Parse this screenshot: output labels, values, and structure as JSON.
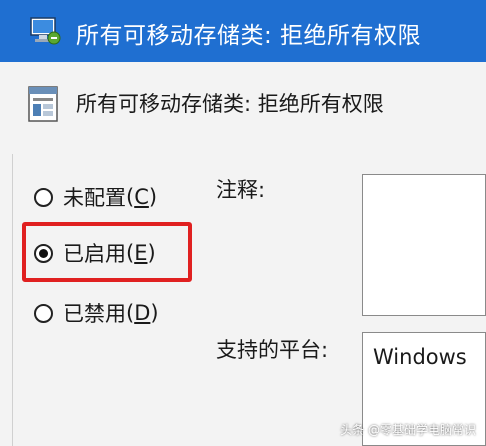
{
  "window": {
    "title": "所有可移动存储类: 拒绝所有权限",
    "title_bar_color": "#1f6fd1"
  },
  "policy": {
    "title": "所有可移动存储类: 拒绝所有权限"
  },
  "options": [
    {
      "label": "未配置",
      "accel": "C",
      "checked": false
    },
    {
      "label": "已启用",
      "accel": "E",
      "checked": true
    },
    {
      "label": "已禁用",
      "accel": "D",
      "checked": false
    }
  ],
  "fields": {
    "comment_label": "注释:",
    "platform_label": "支持的平台:",
    "platform_value": "Windows"
  },
  "highlight_color": "#e02020",
  "watermark": "头条 @零基础学电脑常识"
}
